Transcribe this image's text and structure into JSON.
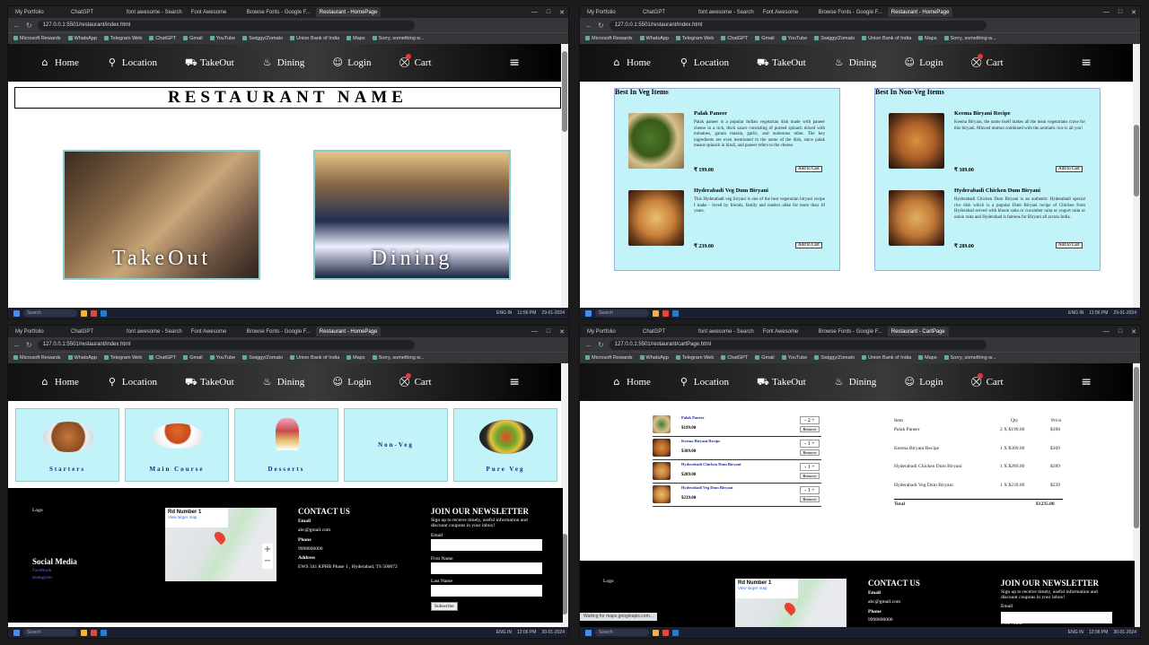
{
  "browser": {
    "tabs_q1": [
      "My Portfolio",
      "ChatGPT",
      "font awesome - Search",
      "Font Awesome",
      "Browse Fonts - Google F...",
      "Restaurant - HomePage"
    ],
    "tabs_q2": [
      "My Portfolio",
      "ChatGPT",
      "font awesome - Search",
      "Font Awesome",
      "Browse Fonts - Google F...",
      "Restaurant - HomePage"
    ],
    "tabs_q3": [
      "My Portfolio",
      "ChatGPT",
      "font awesome - Search",
      "Font Awesome",
      "Browse Fonts - Google F...",
      "Restaurant - HomePage"
    ],
    "tabs_q4": [
      "My Portfolio",
      "ChatGPT",
      "font awesome - Search",
      "Font Awesome",
      "Browse Fonts - Google F...",
      "Restaurant - CartPage"
    ],
    "url_index": "127.0.0.1:5501/restaurant/index.html",
    "url_cart": "127.0.0.1:5501/restaurant/cartPage.html",
    "bookmarks": [
      "Microsoft Rewards",
      "WhatsApp",
      "Telegram Web",
      "ChatGPT",
      "Gmail",
      "YouTube",
      "Swiggy/Zomato",
      "Union Bank of India",
      "Maps",
      "Sorry, something w..."
    ],
    "window_controls": [
      "—",
      "□",
      "✕"
    ]
  },
  "nav": {
    "home": "Home",
    "location": "Location",
    "takeout": "TakeOut",
    "dining": "Dining",
    "login": "Login",
    "cart": "Cart"
  },
  "home": {
    "restaurant_name": "RESTAURANT NAME",
    "card_takeout": "TakeOut",
    "card_dining": "Dining"
  },
  "menu": {
    "veg_title": "Best In Veg Items",
    "nonveg_title": "Best In Non-Veg Items",
    "add_label": "Add to Cart",
    "veg": [
      {
        "name": "Palak Paneer",
        "desc": "Palak paneer is a popular Indian vegetarian dish made with paneer cheese in a rich, thick sauce consisting of pureed spinach mixed with tomatoes, garam masala, garlic, and numerous other. The key ingredients are even mentioned in the name of the dish, since palak means spinach in hindi, and paneer refers to the cheese.",
        "price": "₹ 199.00"
      },
      {
        "name": "Hyderabadi Veg Dum Biryani",
        "desc": "This Hyderabadi veg biryani is one of the best vegetarian biryani recipe I make - loved by friends, family and readers alike for more than 10 years.",
        "price": "₹ 239.00"
      }
    ],
    "nonveg": [
      {
        "name": "Keema Biryani Recipe",
        "desc": "Keema Biryani, the name itself makes all the meat vegetarians crave for this biryani. Minced mutton combined with the aromatic rice is all you!",
        "price": "₹ 309.00"
      },
      {
        "name": "Hyderabadi Chicken Dum Biryani",
        "desc": "Hyderabadi Chicken Dum Biryani is an authentic Hyderabadi special rice dish which is a popular Dum Biryani recipe of Chicken from Hyderabad served with khoon raita or cucumber raita or yogurt raita or onion raita and Hyderabad is famous for Biryani all across India.",
        "price": "₹ 289.00"
      }
    ]
  },
  "categories": [
    "Starters",
    "Main Course",
    "Desserts",
    "Non-Veg",
    "Pure Veg"
  ],
  "footer": {
    "logo": "Logo",
    "social_title": "Social Media",
    "social_links": [
      "Facebook",
      "Instagram"
    ],
    "map_place": "Rd Number 1",
    "map_link": "View larger map",
    "contact_title": "CONTACT US",
    "email_label": "Email",
    "email_value": "abc@gmail.com",
    "phone_label": "Phone",
    "phone_value": "9998800000",
    "address_label": "Address",
    "address_value": "EWS 341 KPHB Phase 1 , Hyderabad, TS 500072",
    "newsletter_title": "JOIN OUR NEWSLETTER",
    "newsletter_text": "Sign up to receive timely, useful information and discount coupons in your inbox!",
    "email_field_label": "Email",
    "first_name_label": "First Name",
    "last_name_label": "Last Name",
    "subscribe": "Subscribe"
  },
  "cart": {
    "items": [
      {
        "name": "Palak Paneer",
        "price": "$199.00",
        "qty": "2"
      },
      {
        "name": "Keema Biryani Recipe",
        "price": "$309.00",
        "qty": "1"
      },
      {
        "name": "Hyderabadi Chicken Dum Biryani",
        "price": "$289.00",
        "qty": "1"
      },
      {
        "name": "Hyderabadi Veg Dum Biryani",
        "price": "$239.00",
        "qty": "1"
      }
    ],
    "remove_label": "Remove",
    "headers": [
      "Item",
      "Qty",
      "Price"
    ],
    "summary": [
      {
        "item": "Palak Paneer",
        "qty": "2 X $199.00",
        "price": "$398"
      },
      {
        "item": "Keema Biryani Recipe",
        "qty": "1 X $309.00",
        "price": "$309"
      },
      {
        "item": "Hyderabadi Chicken Dum Biryani",
        "qty": "1 X $289.00",
        "price": "$289"
      },
      {
        "item": "Hyderabadi Veg Dum Biryani",
        "qty": "1 X $239.00",
        "price": "$239"
      }
    ],
    "total_label": "Total",
    "total_value": "$1235.00",
    "status_text": "Waiting for maps.googleapis.com..."
  },
  "taskbar": {
    "search": "Search",
    "lang": "ENG IN",
    "time_a": "11:56 PM",
    "date_a": "29-01-2024",
    "time_b": "12:06 PM",
    "date_b": "30-01-2024"
  }
}
